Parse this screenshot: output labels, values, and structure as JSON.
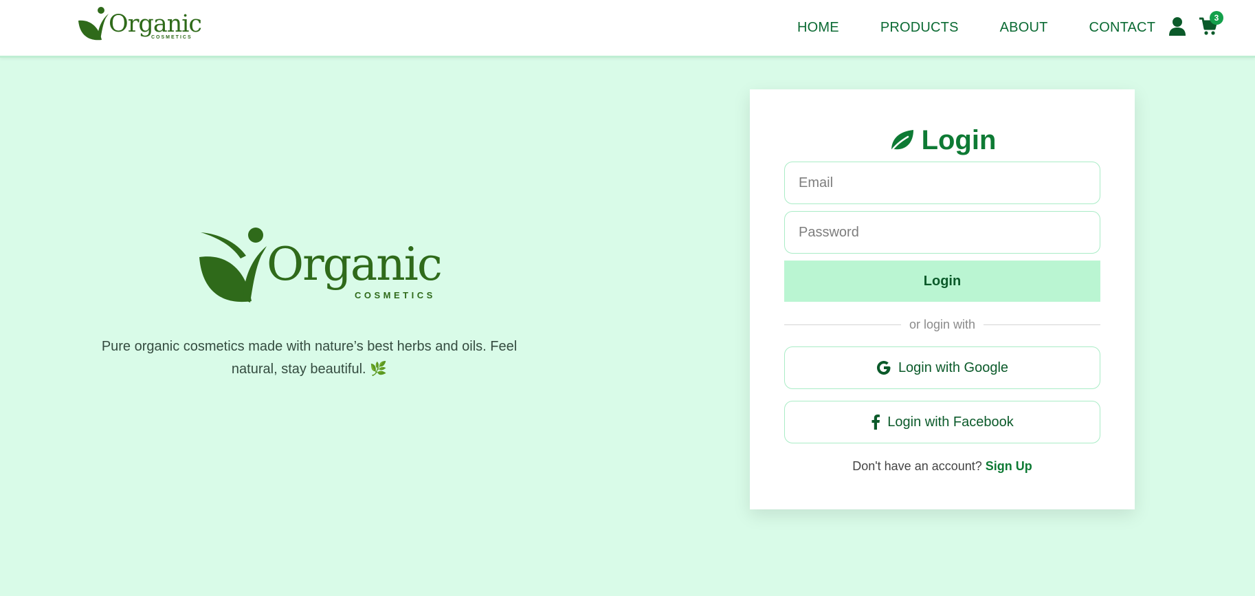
{
  "brand": {
    "name": "Organic",
    "subtitle": "COSMETICS"
  },
  "nav": {
    "items": [
      {
        "label": "HOME"
      },
      {
        "label": "PRODUCTS"
      },
      {
        "label": "ABOUT"
      },
      {
        "label": "CONTACT"
      }
    ],
    "icons": [
      "user-icon",
      "cart-icon"
    ],
    "cart_count": "3"
  },
  "hero": {
    "logo_name": "Organic",
    "logo_subtitle": "COSMETICS",
    "tagline": "Pure organic cosmetics made with nature’s best herbs and oils. Feel natural, stay beautiful. 🌿"
  },
  "login": {
    "title": "Login",
    "title_icon": "leaf-icon",
    "email_placeholder": "Email",
    "password_placeholder": "Password",
    "submit_label": "Login",
    "divider_text": "or login with",
    "google_label": "Login with Google",
    "facebook_label": "Login with Facebook",
    "signup_prompt": "Don't have an account?",
    "signup_link": "Sign Up"
  },
  "colors": {
    "background": "#d9fbe8",
    "primary": "#0e7a34",
    "logo_green": "#2f6a1a",
    "button_bg": "#baf5d2",
    "badge": "#14a04b"
  }
}
